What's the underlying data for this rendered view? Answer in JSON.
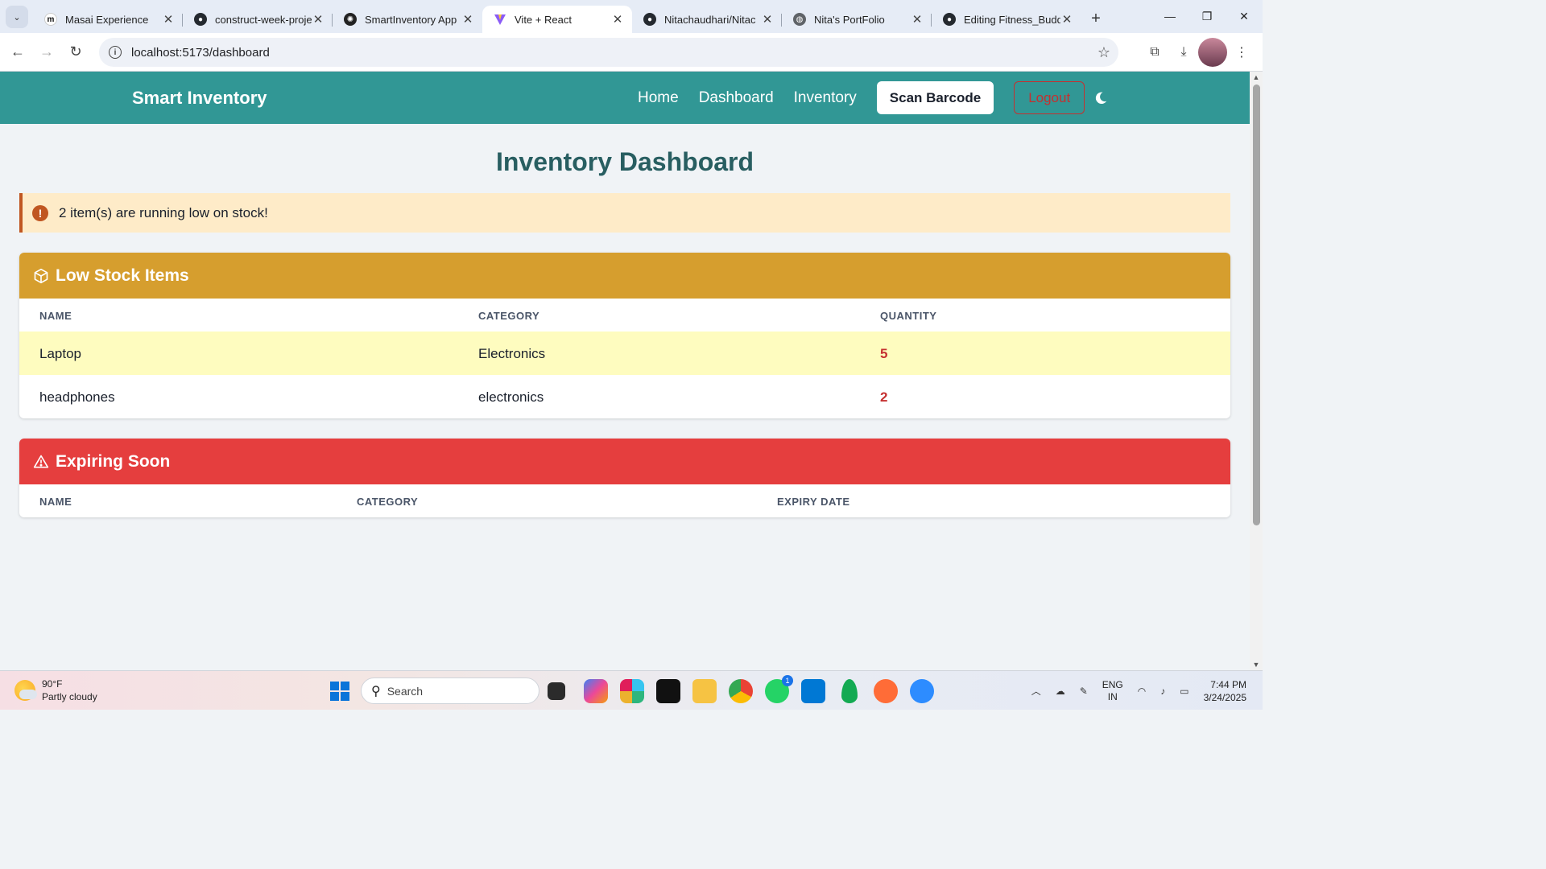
{
  "browser": {
    "tabs": [
      {
        "label": "Masai Experience",
        "favicon": "m",
        "favicon_color": "#111111"
      },
      {
        "label": "construct-week-proje",
        "favicon": "github",
        "favicon_color": "#24292f"
      },
      {
        "label": "SmartInventory App",
        "favicon": "openai",
        "favicon_color": "#222222"
      },
      {
        "label": "Vite + React",
        "favicon": "vite",
        "favicon_color": "#8b5cf6",
        "active": true
      },
      {
        "label": "Nitachaudhari/Nitac",
        "favicon": "github",
        "favicon_color": "#24292f"
      },
      {
        "label": "Nita's PortFolio",
        "favicon": "globe",
        "favicon_color": "#5f6368"
      },
      {
        "label": "Editing Fitness_Budd",
        "favicon": "github",
        "favicon_color": "#24292f"
      }
    ],
    "url": "localhost:5173/dashboard"
  },
  "app": {
    "brand": "Smart Inventory",
    "nav": {
      "home": "Home",
      "dashboard": "Dashboard",
      "inventory": "Inventory",
      "scan": "Scan Barcode",
      "logout": "Logout"
    },
    "title": "Inventory Dashboard",
    "alert": "2 item(s) are running low on stock!",
    "low_stock": {
      "title": "Low Stock Items",
      "columns": [
        "NAME",
        "CATEGORY",
        "QUANTITY"
      ],
      "rows": [
        {
          "name": "Laptop",
          "category": "Electronics",
          "quantity": "5"
        },
        {
          "name": "headphones",
          "category": "electronics",
          "quantity": "2"
        }
      ]
    },
    "expiring": {
      "title": "Expiring Soon",
      "columns": [
        "NAME",
        "CATEGORY",
        "EXPIRY DATE"
      ],
      "rows": []
    },
    "colors": {
      "primary": "#319795",
      "warning": "#d69e2e",
      "danger": "#e53e3e",
      "alert_bg": "#feebc8",
      "highlight_row": "#fefcbf"
    }
  },
  "taskbar": {
    "weather_temp": "90°F",
    "weather_desc": "Partly cloudy",
    "search_placeholder": "Search",
    "lang_top": "ENG",
    "lang_bottom": "IN",
    "time": "7:44 PM",
    "date": "3/24/2025",
    "whatsapp_badge": "1"
  }
}
